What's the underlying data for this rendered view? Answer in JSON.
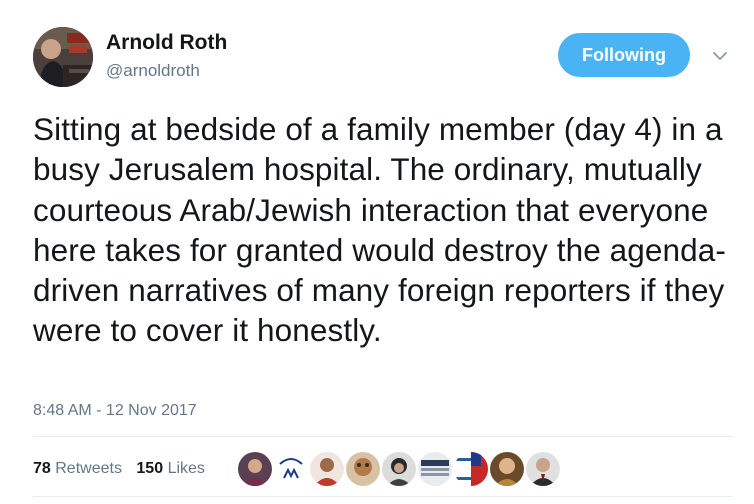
{
  "user": {
    "name": "Arnold Roth",
    "handle": "@arnoldroth",
    "avatar_icon": "profile-photo"
  },
  "follow_button": {
    "label": "Following",
    "color": "#4ab3f4"
  },
  "menu": {
    "icon": "chevron-down-icon"
  },
  "tweet": {
    "text": "Sitting at bedside of a family member (day 4) in a busy Jerusalem hospital. The ordinary, mutually courteous Arab/Jewish interaction that everyone here takes for granted would destroy the agenda-driven narratives of many foreign reporters if they were to cover it honestly.",
    "timestamp": "8:48 AM - 12 Nov 2017"
  },
  "stats": {
    "retweets_count": "78",
    "retweets_label": "Retweets",
    "likes_count": "150",
    "likes_label": "Likes"
  },
  "likers": [
    {
      "icon": "liker-avatar-1",
      "color": "#6a4a5a"
    },
    {
      "icon": "liker-avatar-mpc",
      "color": "#ffffff"
    },
    {
      "icon": "liker-avatar-3",
      "color": "#c0392b"
    },
    {
      "icon": "liker-avatar-4",
      "color": "#c9a27a"
    },
    {
      "icon": "liker-avatar-5",
      "color": "#3f3f3f"
    },
    {
      "icon": "liker-avatar-6",
      "color": "#2a3b55"
    },
    {
      "icon": "liker-avatar-flags",
      "color": "#2d5aa8"
    },
    {
      "icon": "liker-avatar-8",
      "color": "#b8863b"
    },
    {
      "icon": "liker-avatar-9",
      "color": "#2b2b2b"
    }
  ],
  "colors": {
    "text": "#14171a",
    "secondary": "#657786",
    "divider": "#e6ecf0"
  }
}
